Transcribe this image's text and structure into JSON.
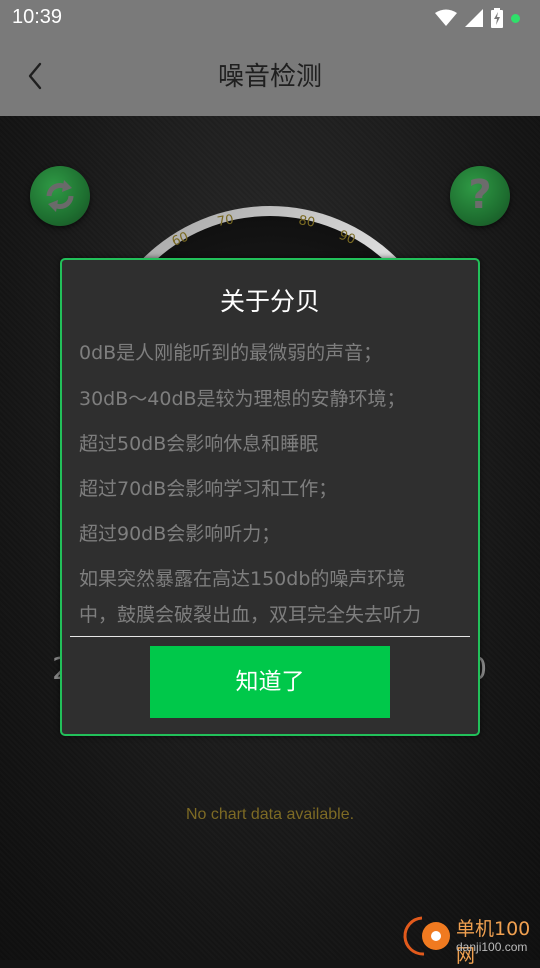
{
  "status_bar": {
    "time": "10:39"
  },
  "header": {
    "title": "噪音检测"
  },
  "gauge": {
    "ticks": [
      "60",
      "70",
      "80",
      "90"
    ]
  },
  "side_values": {
    "left": "2",
    "right": "0"
  },
  "empty_chart_text": "No chart data available.",
  "dialog": {
    "title": "关于分贝",
    "lines": [
      "0dB是人刚能听到的最微弱的声音；",
      "30dB～40dB是较为理想的安静环境；",
      "超过50dB会影响休息和睡眠",
      "超过70dB会影响学习和工作；",
      "超过90dB会影响听力；",
      "如果突然暴露在高达150db的噪声环境",
      "中，鼓膜会破裂出血，双耳完全失去听力"
    ],
    "confirm_label": "知道了"
  },
  "watermark": {
    "name": "单机100网",
    "domain": "danji100.com"
  },
  "colors": {
    "accent": "#00c84a",
    "dialog_border": "#22c05a",
    "header_bg": "#7a7a7a"
  }
}
